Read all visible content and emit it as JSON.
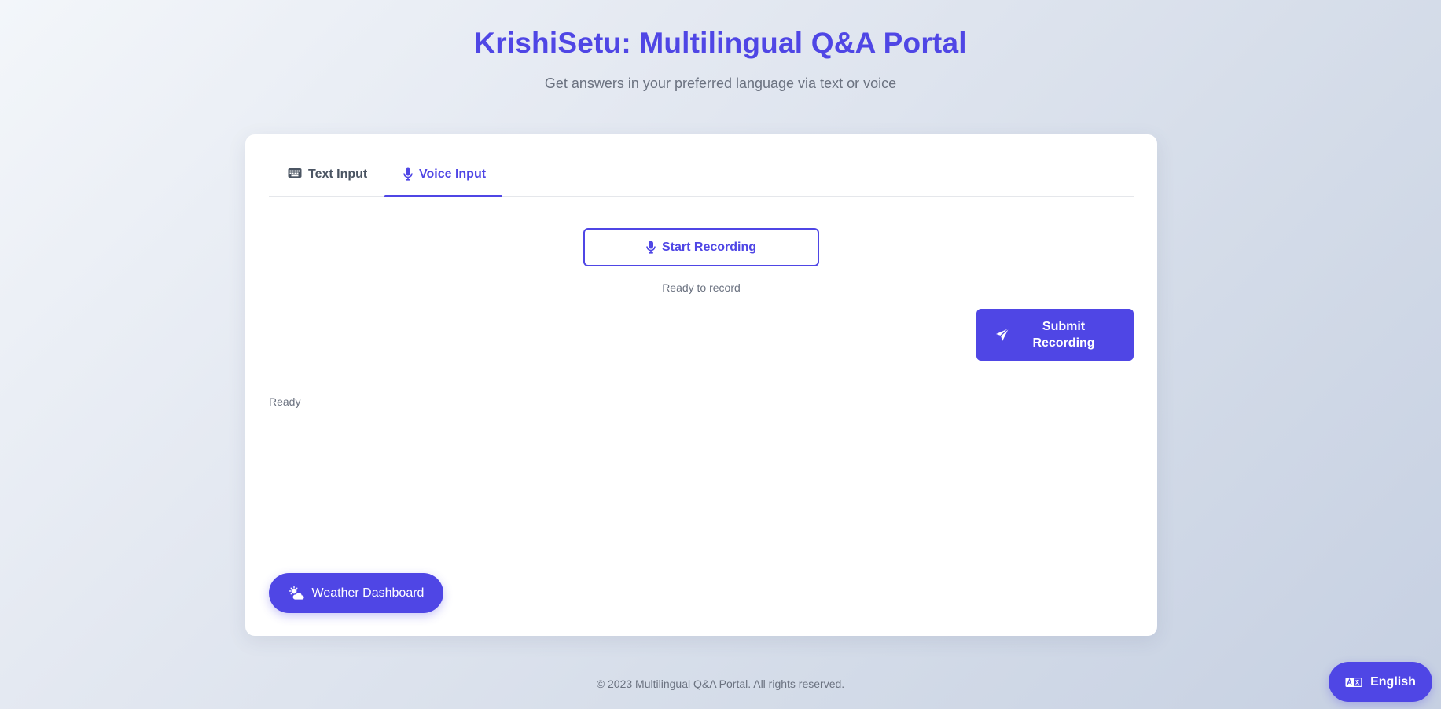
{
  "header": {
    "title": "KrishiSetu: Multilingual Q&A Portal",
    "subtitle": "Get answers in your preferred language via text or voice"
  },
  "tabs": [
    {
      "label": "Text Input",
      "icon": "keyboard-icon",
      "active": false
    },
    {
      "label": "Voice Input",
      "icon": "microphone-icon",
      "active": true
    }
  ],
  "voice": {
    "record_label": "Start Recording",
    "record_status": "Ready to record",
    "submit_label": "Submit Recording"
  },
  "status": "Ready",
  "weather_button": {
    "label": "Weather Dashboard",
    "icon": "cloud-sun-icon"
  },
  "footer": {
    "text": "© 2023 Multilingual Q&A Portal. All rights reserved."
  },
  "language_button": {
    "label": "English",
    "icon": "language-icon"
  },
  "colors": {
    "accent": "#4f46e5",
    "muted_text": "#6b7280",
    "card": "#ffffff"
  }
}
